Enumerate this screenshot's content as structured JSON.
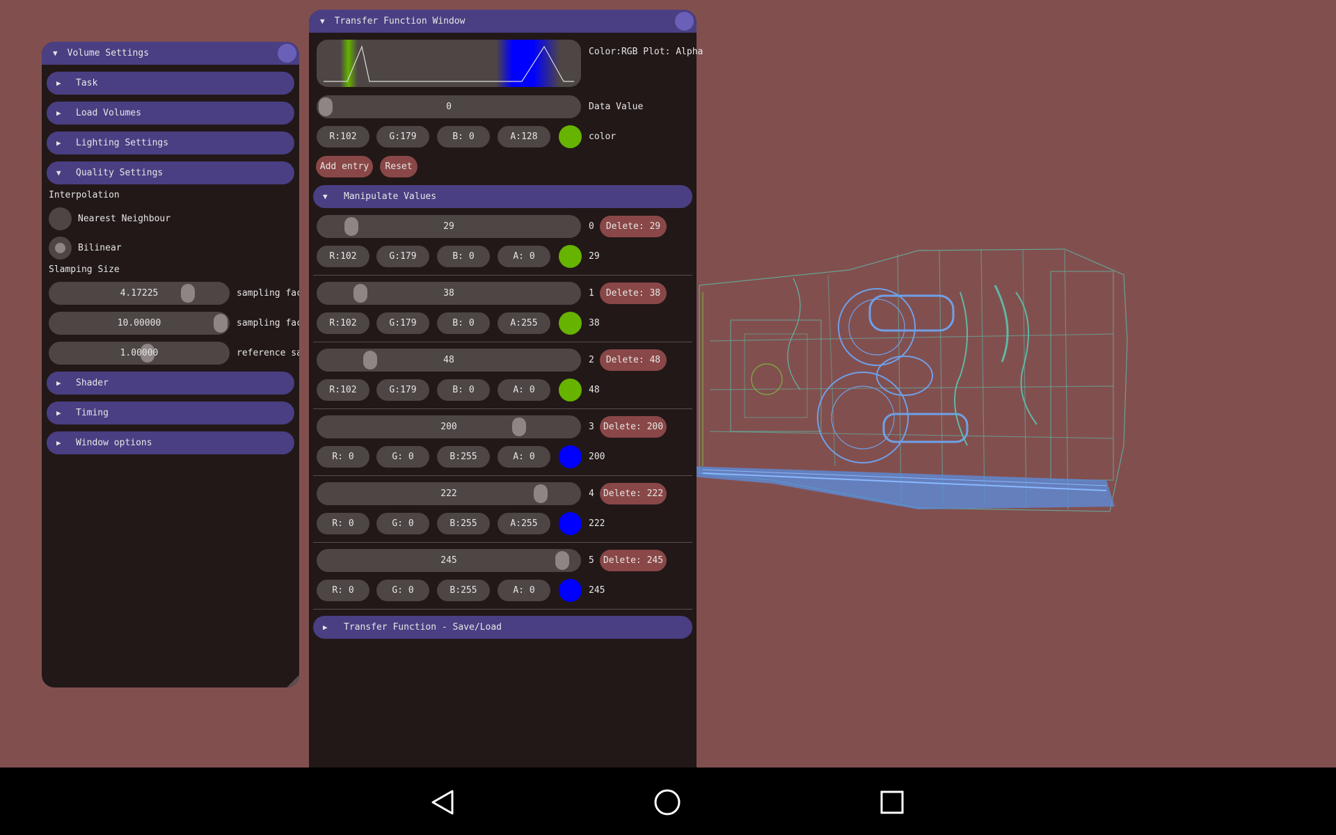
{
  "volume_settings": {
    "title": "Volume Settings",
    "sections": {
      "task": "Task",
      "load_volumes": "Load Volumes",
      "lighting": "Lighting Settings",
      "quality": "Quality Settings",
      "shader": "Shader",
      "timing": "Timing",
      "window_options": "Window options"
    },
    "interpolation_label": "Interpolation",
    "interp_options": [
      "Nearest Neighbour",
      "Bilinear"
    ],
    "selected_interp": "Bilinear",
    "sampling_label": "Slamping Size",
    "sliders": [
      {
        "value": "4.17225",
        "label": "sampling fac"
      },
      {
        "value": "10.00000",
        "label": "sampling fac"
      },
      {
        "value": "1.00000",
        "label": "reference sa"
      }
    ]
  },
  "transfer_function": {
    "title": "Transfer Function Window",
    "plot_label": "Color:RGB Plot: Alpha",
    "data_value": "0",
    "data_value_label": "Data Value",
    "current": {
      "r": "R:102",
      "g": "G:179",
      "b": "B:  0",
      "a": "A:128",
      "swatch": "#66b300"
    },
    "color_label": "color",
    "add_entry": "Add entry",
    "reset": "Reset",
    "manipulate_title": "Manipulate Values",
    "entries": [
      {
        "value": "29",
        "index": "0",
        "delete": "Delete: 29",
        "r": "R:102",
        "g": "G:179",
        "b": "B:  0",
        "a": "A:  0",
        "color": "#66b300",
        "label": "29"
      },
      {
        "value": "38",
        "index": "1",
        "delete": "Delete: 38",
        "r": "R:102",
        "g": "G:179",
        "b": "B:  0",
        "a": "A:255",
        "color": "#66b300",
        "label": "38"
      },
      {
        "value": "48",
        "index": "2",
        "delete": "Delete: 48",
        "r": "R:102",
        "g": "G:179",
        "b": "B:  0",
        "a": "A:  0",
        "color": "#66b300",
        "label": "48"
      },
      {
        "value": "200",
        "index": "3",
        "delete": "Delete: 200",
        "r": "R:  0",
        "g": "G:  0",
        "b": "B:255",
        "a": "A:  0",
        "color": "#0000ff",
        "label": "200"
      },
      {
        "value": "222",
        "index": "4",
        "delete": "Delete: 222",
        "r": "R:  0",
        "g": "G:  0",
        "b": "B:255",
        "a": "A:255",
        "color": "#0000ff",
        "label": "222"
      },
      {
        "value": "245",
        "index": "5",
        "delete": "Delete: 245",
        "r": "R:  0",
        "g": "G:  0",
        "b": "B:255",
        "a": "A:  0",
        "color": "#0000ff",
        "label": "245"
      }
    ],
    "save_load_title": "Transfer Function - Save/Load"
  },
  "colors": {
    "background": "#824f4f",
    "panel": "#221818",
    "header": "#4a3f82",
    "control": "#4e4545",
    "button": "#8a4747"
  },
  "nav_icons": [
    "back-icon",
    "home-icon",
    "recents-icon"
  ]
}
